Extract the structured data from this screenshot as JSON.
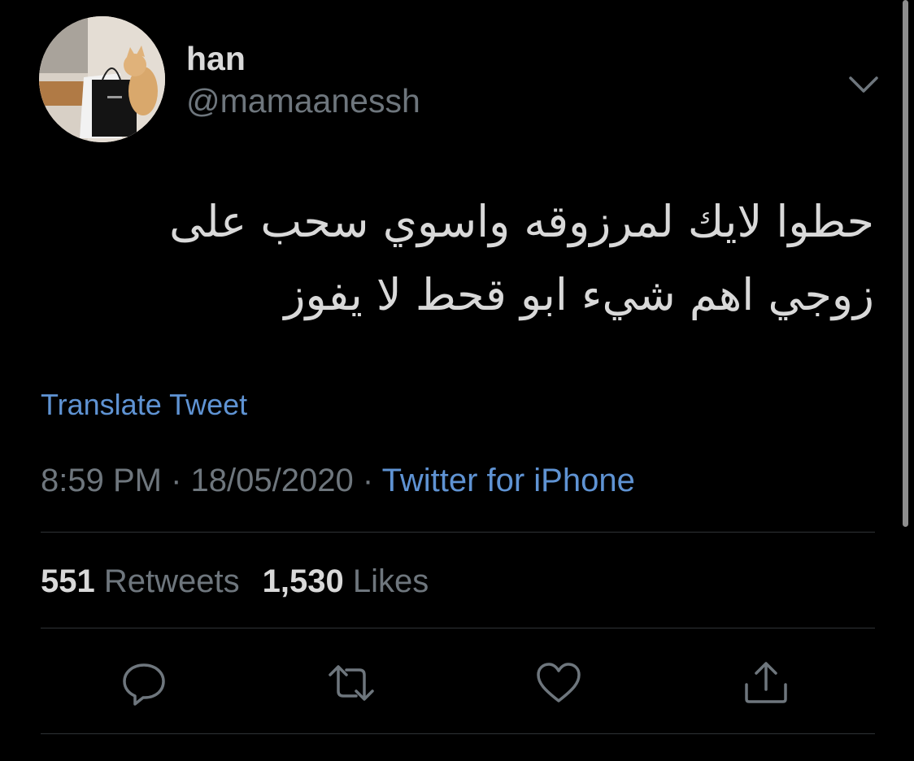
{
  "user": {
    "display_name": "han",
    "handle": "@mamaanessh"
  },
  "tweet": {
    "text_line1": "حطوا لايك لمرزوقه واسوي سحب على",
    "text_line2": "زوجي اهم شيء ابو قحط لا يفوز",
    "translate_label": "Translate Tweet",
    "time": "8:59 PM",
    "date": "18/05/2020",
    "separator": "·",
    "source": "Twitter for iPhone"
  },
  "stats": {
    "retweets_count": "551",
    "retweets_label": "Retweets",
    "likes_count": "1,530",
    "likes_label": "Likes"
  },
  "actions": {
    "icons": [
      "reply-icon",
      "retweet-icon",
      "like-icon",
      "share-icon"
    ]
  },
  "colors": {
    "background": "#000000",
    "text": "#d9d9d9",
    "muted": "#6e767d",
    "link": "#5f93d3",
    "divider": "#2f3336"
  }
}
